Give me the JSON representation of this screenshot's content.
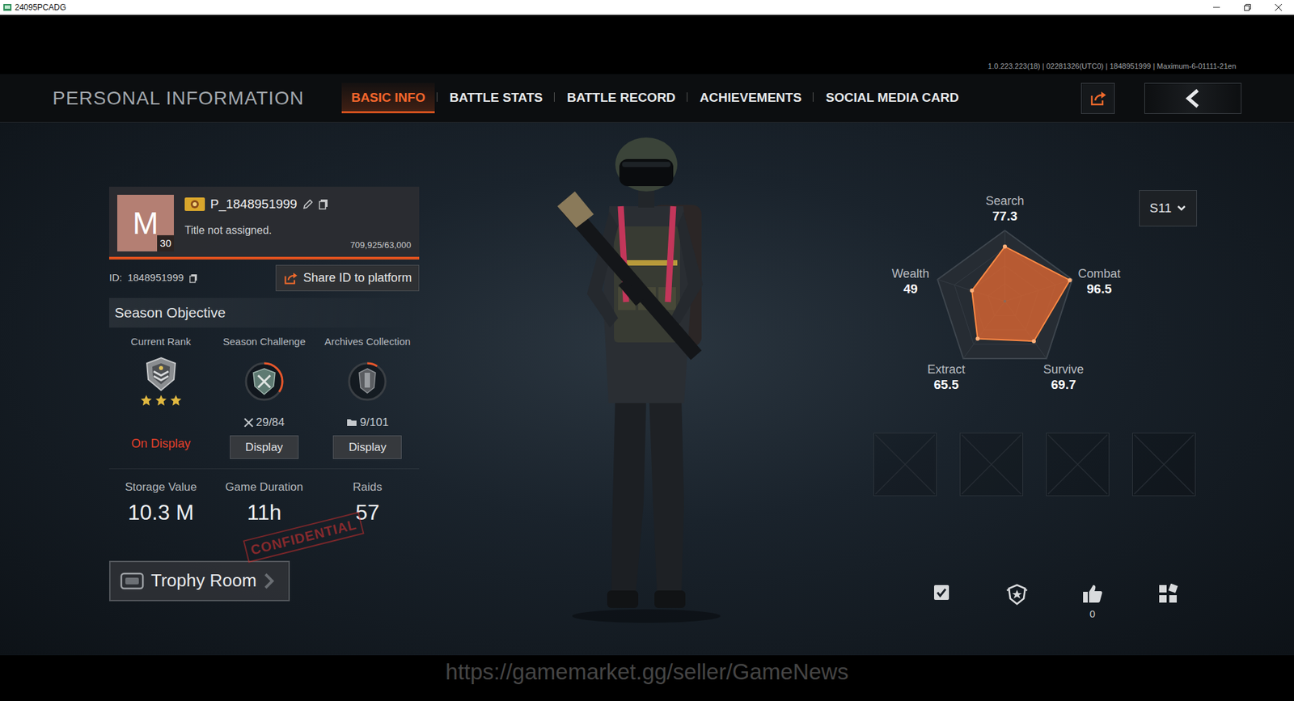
{
  "window": {
    "title": "24095PCADG"
  },
  "header": {
    "title": "PERSONAL INFORMATION",
    "version": "1.0.223.223(18) | 02281326(UTC0) | 1848951999 | Maximum-6-01111-21en"
  },
  "tabs": [
    {
      "label": "BASIC INFO",
      "selected": true
    },
    {
      "label": "BATTLE STATS",
      "selected": false
    },
    {
      "label": "BATTLE RECORD",
      "selected": false
    },
    {
      "label": "ACHIEVEMENTS",
      "selected": false
    },
    {
      "label": "SOCIAL MEDIA CARD",
      "selected": false
    }
  ],
  "profile": {
    "avatar_letter": "M",
    "level": "30",
    "name": "P_1848951999",
    "title": "Title not assigned.",
    "xp": "709,925/63,000",
    "xp_level": 1,
    "id_label": "ID:",
    "id": "1848951999",
    "share_button": "Share ID to platform"
  },
  "season": {
    "heading": "Season Objective",
    "objectives": [
      {
        "kind": "rank",
        "label": "Current Rank",
        "stars": 3,
        "action": "On Display",
        "displayed": true
      },
      {
        "kind": "challenge",
        "label": "Season Challenge",
        "count": "29/84",
        "level": 0.345,
        "action": "Display",
        "displayed": false
      },
      {
        "kind": "collection",
        "label": "Archives Collection",
        "count": "9/101",
        "level": 0.09,
        "action": "Display",
        "displayed": false
      }
    ]
  },
  "stats": [
    {
      "label": "Storage Value",
      "value": "10.3 M"
    },
    {
      "label": "Game Duration",
      "value": "11h"
    },
    {
      "label": "Raids",
      "value": "57"
    }
  ],
  "stamp": "CONFIDENTIAL",
  "trophy_button": "Trophy Room",
  "season_select": {
    "value": "S11"
  },
  "radar": {
    "axes": [
      {
        "label": "Search",
        "reading": "77.3"
      },
      {
        "label": "Combat",
        "reading": "96.5"
      },
      {
        "label": "Survive",
        "reading": "69.7"
      },
      {
        "label": "Extract",
        "reading": "65.5"
      },
      {
        "label": "Wealth",
        "reading": "49"
      }
    ],
    "series": [
      {
        "values": [
          77.3,
          96.5,
          69.7,
          65.5,
          49
        ]
      }
    ]
  },
  "slots": [
    {
      "empty": true
    },
    {
      "empty": true
    },
    {
      "empty": true
    },
    {
      "empty": true
    }
  ],
  "actions": [
    {
      "kind": "check"
    },
    {
      "kind": "badge"
    },
    {
      "kind": "like",
      "count": "0"
    },
    {
      "kind": "apps"
    }
  ],
  "watermark": "https://gamemarket.gg/seller/GameNews"
}
